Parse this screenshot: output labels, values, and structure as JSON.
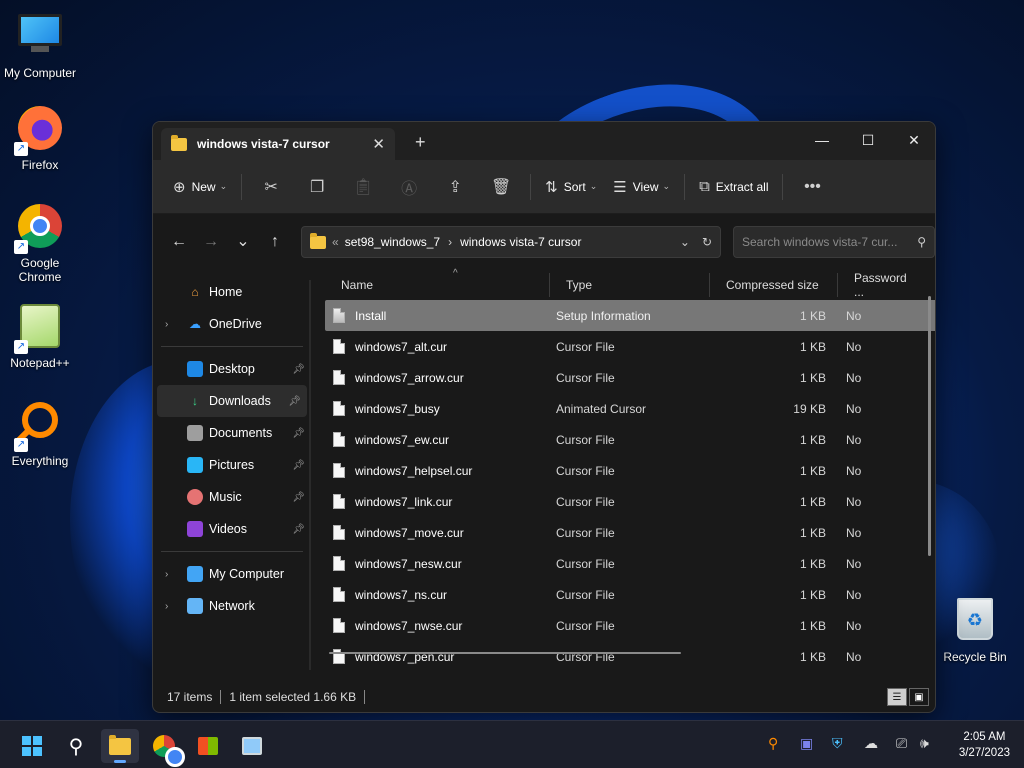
{
  "desktop": {
    "icons": [
      {
        "label": "My Computer"
      },
      {
        "label": "Firefox"
      },
      {
        "label": "Google Chrome"
      },
      {
        "label": "Notepad++"
      },
      {
        "label": "Everything"
      },
      {
        "label": "Recycle Bin"
      }
    ]
  },
  "window": {
    "tab_title": "windows vista-7 cursor",
    "toolbar": {
      "new_label": "New",
      "sort_label": "Sort",
      "view_label": "View",
      "extract_label": "Extract all"
    },
    "address": {
      "overflow": "«",
      "crumbs": [
        "set98_windows_7",
        "windows vista-7 cursor"
      ]
    },
    "search": {
      "placeholder": "Search windows vista-7 cur..."
    },
    "nav": {
      "home": "Home",
      "onedrive": "OneDrive",
      "desktop": "Desktop",
      "downloads": "Downloads",
      "documents": "Documents",
      "pictures": "Pictures",
      "music": "Music",
      "videos": "Videos",
      "mycomputer": "My Computer",
      "network": "Network"
    },
    "columns": {
      "name": "Name",
      "type": "Type",
      "size": "Compressed size",
      "password": "Password ..."
    },
    "files": [
      {
        "name": "Install",
        "type": "Setup Information",
        "size": "1 KB",
        "pw": "No"
      },
      {
        "name": "windows7_alt.cur",
        "type": "Cursor File",
        "size": "1 KB",
        "pw": "No"
      },
      {
        "name": "windows7_arrow.cur",
        "type": "Cursor File",
        "size": "1 KB",
        "pw": "No"
      },
      {
        "name": "windows7_busy",
        "type": "Animated Cursor",
        "size": "19 KB",
        "pw": "No"
      },
      {
        "name": "windows7_ew.cur",
        "type": "Cursor File",
        "size": "1 KB",
        "pw": "No"
      },
      {
        "name": "windows7_helpsel.cur",
        "type": "Cursor File",
        "size": "1 KB",
        "pw": "No"
      },
      {
        "name": "windows7_link.cur",
        "type": "Cursor File",
        "size": "1 KB",
        "pw": "No"
      },
      {
        "name": "windows7_move.cur",
        "type": "Cursor File",
        "size": "1 KB",
        "pw": "No"
      },
      {
        "name": "windows7_nesw.cur",
        "type": "Cursor File",
        "size": "1 KB",
        "pw": "No"
      },
      {
        "name": "windows7_ns.cur",
        "type": "Cursor File",
        "size": "1 KB",
        "pw": "No"
      },
      {
        "name": "windows7_nwse.cur",
        "type": "Cursor File",
        "size": "1 KB",
        "pw": "No"
      },
      {
        "name": "windows7_pen.cur",
        "type": "Cursor File",
        "size": "1 KB",
        "pw": "No"
      }
    ],
    "status": {
      "items": "17 items",
      "selected": "1 item selected  1.66 KB"
    }
  },
  "taskbar": {
    "clock_time": "2:05 AM",
    "clock_date": "3/27/2023"
  },
  "colors": {
    "accent": "#4cc2ff",
    "selected_row": "#777777",
    "window_bg": "#191919"
  }
}
